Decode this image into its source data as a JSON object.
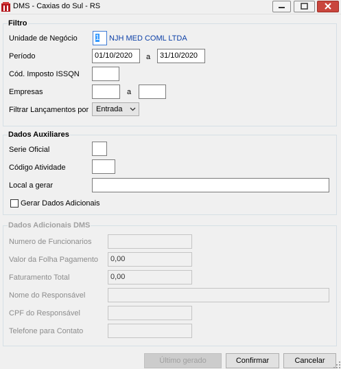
{
  "window": {
    "title": "DMS - Caxias do Sul - RS"
  },
  "filtro": {
    "title": "Filtro",
    "unidade_label": "Unidade de Negócio",
    "unidade_code": "1",
    "unidade_name": "NJH MED COML LTDA",
    "periodo_label": "Período",
    "periodo_from": "01/10/2020",
    "periodo_sep": "a",
    "periodo_to": "31/10/2020",
    "cod_imposto_label": "Cód. Imposto ISSQN",
    "cod_imposto_value": "",
    "empresas_label": "Empresas",
    "empresas_from": "",
    "empresas_sep": "a",
    "empresas_to": "",
    "filtrar_label": "Filtrar Lançamentos por",
    "filtrar_value": "Entrada"
  },
  "auxiliares": {
    "title": "Dados Auxiliares",
    "serie_label": "Serie Oficial",
    "serie_value": "",
    "codigo_label": "Código Atividade",
    "codigo_value": "",
    "local_label": "Local a gerar",
    "local_value": "",
    "gerar_label": "Gerar Dados Adicionais",
    "gerar_checked": false
  },
  "adicionais": {
    "title": "Dados Adicionais DMS",
    "funcionarios_label": "Numero de Funcionarios",
    "funcionarios_value": "",
    "folha_label": "Valor da Folha Pagamento",
    "folha_value": "0,00",
    "faturamento_label": "Faturamento Total",
    "faturamento_value": "0,00",
    "responsavel_label": "Nome do Responsável",
    "responsavel_value": "",
    "cpf_label": "CPF do Responsável",
    "cpf_value": "",
    "telefone_label": "Telefone para Contato",
    "telefone_value": ""
  },
  "buttons": {
    "ultimo": "Último gerado",
    "confirmar": "Confirmar",
    "cancelar": "Cancelar"
  },
  "colors": {
    "accent_link": "#0b3fa7",
    "close_button": "#c9463d",
    "window_bg": "#f0f0f0"
  }
}
